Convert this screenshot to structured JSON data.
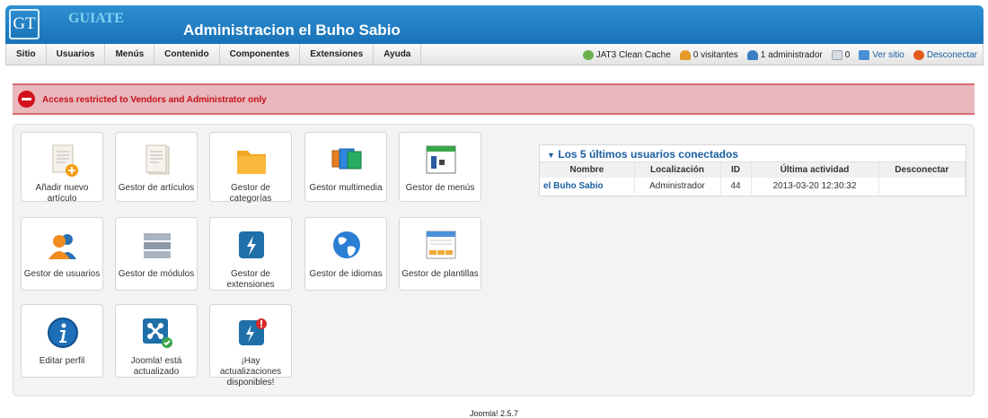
{
  "header": {
    "logo": "GT",
    "brand": "GUIATE",
    "site_title": "Administracion el Buho Sabio"
  },
  "menu": [
    "Sitio",
    "Usuarios",
    "Menús",
    "Contenido",
    "Componentes",
    "Extensiones",
    "Ayuda"
  ],
  "status": {
    "clean_cache": "JAT3 Clean Cache",
    "visitors": "0 visitantes",
    "admins": "1 administrador",
    "messages": "0",
    "view_site": "Ver sitio",
    "logout": "Desconectar"
  },
  "alert": {
    "text": "Access restricted to Vendors and Administrator only",
    "color": "#c8101a"
  },
  "quickicons": [
    {
      "label": "Añadir nuevo artículo",
      "icon": "add-article-icon"
    },
    {
      "label": "Gestor de artículos",
      "icon": "article-manager-icon"
    },
    {
      "label": "Gestor de categorías",
      "icon": "folder-icon"
    },
    {
      "label": "Gestor multimedia",
      "icon": "media-icon"
    },
    {
      "label": "Gestor de menús",
      "icon": "menu-manager-icon"
    },
    {
      "label": "Gestor de usuarios",
      "icon": "users-icon"
    },
    {
      "label": "Gestor de módulos",
      "icon": "modules-icon"
    },
    {
      "label": "Gestor de extensiones",
      "icon": "extensions-icon"
    },
    {
      "label": "Gestor de idiomas",
      "icon": "globe-icon"
    },
    {
      "label": "Gestor de plantillas",
      "icon": "templates-icon"
    },
    {
      "label": "Editar perfil",
      "icon": "info-icon"
    },
    {
      "label": "Joomla! está actualizado",
      "icon": "joomla-icon"
    },
    {
      "label": "¡Hay actualizaciones disponibles!",
      "icon": "updates-icon"
    }
  ],
  "last_users": {
    "title": "Los 5 últimos usuarios conectados",
    "columns": [
      "Nombre",
      "Localización",
      "ID",
      "Última actividad",
      "Desconectar"
    ],
    "rows": [
      {
        "name": "el Buho Sabio",
        "location": "Administrador",
        "id": "44",
        "last_activity": "2013-03-20 12:30:32",
        "logout": ""
      }
    ]
  },
  "footer": "Joomla! 2.5.7"
}
